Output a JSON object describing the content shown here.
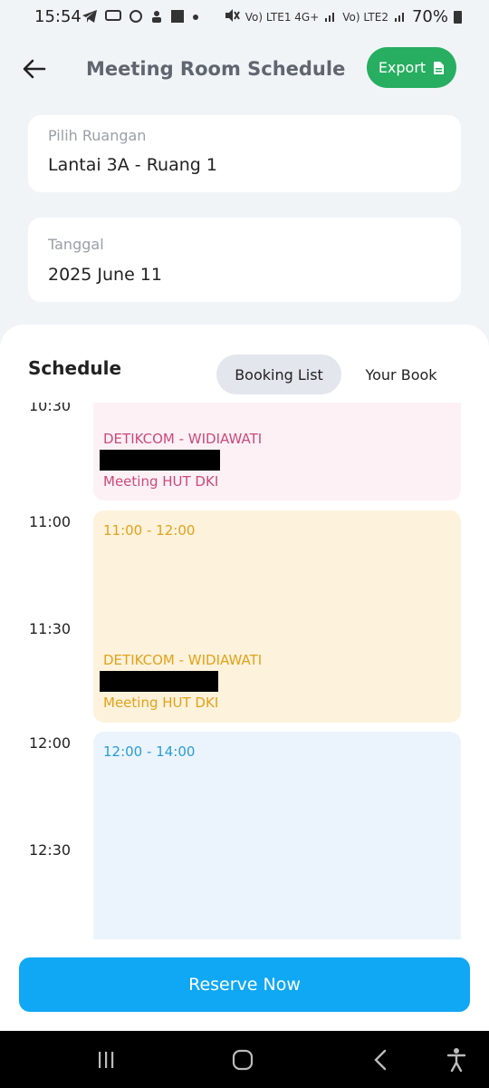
{
  "status_bar": {
    "time": "15:54",
    "battery": "70%",
    "network_1": "Vo) LTE1 4G+",
    "network_2": "Vo) LTE2",
    "icons": [
      "telegram-icon",
      "app-icon",
      "app-icon",
      "app-icon",
      "app-icon",
      "mute-icon",
      "signal-icon",
      "battery-icon"
    ]
  },
  "header": {
    "title": "Meeting Room Schedule",
    "export_label": "Export"
  },
  "room_field": {
    "label": "Pilih Ruangan",
    "value": "Lantai 3A - Ruang 1"
  },
  "date_field": {
    "label": "Tanggal",
    "value": "2025 June 11"
  },
  "schedule": {
    "title": "Schedule",
    "tabs": [
      {
        "label": "Booking List",
        "active": true
      },
      {
        "label": "Your Book",
        "active": false
      }
    ],
    "time_labels": [
      "10:30",
      "11:00",
      "11:30",
      "12:00",
      "12:30"
    ],
    "events": [
      {
        "time": "",
        "company": "DETIKCOM - WIDIAWATI",
        "title": "Meeting HUT DKI",
        "color": "#cc4a7a"
      },
      {
        "time": "11:00 - 12:00",
        "company": "DETIKCOM - WIDIAWATI",
        "title": "Meeting HUT DKI",
        "color": "#e2a21a"
      },
      {
        "time": "12:00 - 14:00",
        "company": "",
        "title": "",
        "color": "#2a9cd8"
      }
    ]
  },
  "reserve_label": "Reserve Now",
  "colors": {
    "accent": "#10a8f4",
    "export": "#27ae60",
    "background": "#f1f4f7"
  }
}
